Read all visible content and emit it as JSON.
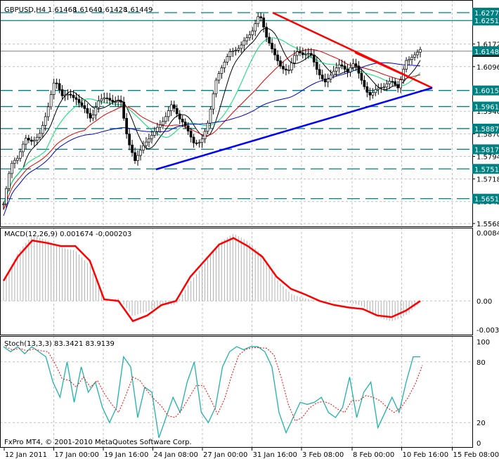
{
  "header": {
    "symbol": "GBPUSD,H4",
    "open": "1.61468",
    "high": "1.61640",
    "low": "1.61428",
    "close": "1.61449"
  },
  "footer": {
    "copyright": "FxPro MT4, © 2001-2010 MetaQuotes Software Corp."
  },
  "colors": {
    "bull": "#000000",
    "teal": "#008080",
    "red": "#ff0000",
    "blue": "#0000ff",
    "ma_fast": "#000000",
    "ma_green": "#00e070",
    "ma_red": "#e00000",
    "ma_blue": "#0000cc"
  },
  "chart_data": [
    {
      "type": "candlestick",
      "title": "GBPUSD,H4",
      "ylim": [
        1.5568,
        1.62777
      ],
      "y_ticks": [
        "1.61720",
        "1.60960",
        "1.59460",
        "1.58700",
        "1.57940",
        "1.57180",
        "1.56420",
        "1.55680"
      ],
      "levels": [
        {
          "label": "1.62777",
          "value": 1.62777,
          "style": "dashed"
        },
        {
          "label": "1.62511",
          "value": 1.62511,
          "style": "solid"
        },
        {
          "label": "1.61481",
          "value": 1.61481,
          "style": "current"
        },
        {
          "label": "1.60159",
          "value": 1.60159,
          "style": "dashed"
        },
        {
          "label": "1.59617",
          "value": 1.59617,
          "style": "dashed"
        },
        {
          "label": "1.58875",
          "value": 1.58875,
          "style": "dashed"
        },
        {
          "label": "1.58178",
          "value": 1.58178,
          "style": "dashed"
        },
        {
          "label": "1.57519",
          "value": 1.57519,
          "style": "dashed"
        },
        {
          "label": "1.56516",
          "value": 1.56516,
          "style": "dashed"
        }
      ],
      "x_ticks": [
        "12 Jan 2011",
        "17 Jan 00:00",
        "19 Jan 16:00",
        "24 Jan 08:00",
        "27 Jan 00:00",
        "31 Jan 16:00",
        "3 Feb 08:00",
        "8 Feb 00:00",
        "10 Feb 16:00",
        "15 Feb 08:00"
      ],
      "closes": [
        1.5634,
        1.5752,
        1.5776,
        1.5859,
        1.5859,
        1.5883,
        1.5942,
        1.6036,
        1.5989,
        1.6013,
        1.6001,
        1.5965,
        1.5906,
        1.5965,
        1.5989,
        1.5989,
        1.6001,
        1.5847,
        1.5764,
        1.5812,
        1.5859,
        1.5906,
        1.593,
        1.5965,
        1.5906,
        1.5883,
        1.5847,
        1.5859,
        1.5918,
        1.6036,
        1.6084,
        1.6143,
        1.6166,
        1.6202,
        1.6214,
        1.6261,
        1.6178,
        1.6143,
        1.6107,
        1.6095,
        1.6143,
        1.6119,
        1.6131,
        1.6084,
        1.606,
        1.6084,
        1.6095,
        1.606,
        1.6107,
        1.606,
        1.6013,
        1.6024,
        1.6013,
        1.6036,
        1.6024,
        1.6131,
        1.6143,
        1.615
      ]
    },
    {
      "type": "line",
      "title": "MACD(12,26,9) 0.001674 -0.000203",
      "ylim": [
        -0.00356,
        0.00847
      ],
      "y_ticks": [
        "0.00847",
        "0.00",
        "-0.00356"
      ],
      "signal": [
        0.0025,
        0.0055,
        0.0075,
        0.0072,
        0.0068,
        0.0068,
        0.005,
        0.0002,
        0.0,
        -0.0025,
        -0.0018,
        -0.0005,
        0.0,
        0.003,
        0.005,
        0.007,
        0.0078,
        0.0068,
        0.0055,
        0.003,
        0.0015,
        0.0008,
        0.0,
        -0.0005,
        -0.0008,
        -0.001,
        -0.0018,
        -0.002,
        -0.0012,
        0.0
      ]
    },
    {
      "type": "line",
      "title": "Stoch(13,3,3) 83.3421 83.9139",
      "ylim": [
        0,
        100
      ],
      "y_ticks": [
        "100",
        "80",
        "20",
        "0"
      ],
      "k": [
        95,
        90,
        95,
        88,
        95,
        90,
        85,
        60,
        45,
        80,
        40,
        75,
        50,
        60,
        35,
        20,
        35,
        85,
        75,
        25,
        55,
        50,
        5,
        25,
        45,
        30,
        60,
        80,
        30,
        20,
        35,
        75,
        90,
        95,
        92,
        95,
        95,
        90,
        75,
        30,
        10,
        25,
        40,
        38,
        40,
        45,
        30,
        25,
        35,
        65,
        25,
        50,
        60,
        15,
        30,
        45,
        30,
        60,
        85,
        85
      ]
    }
  ]
}
